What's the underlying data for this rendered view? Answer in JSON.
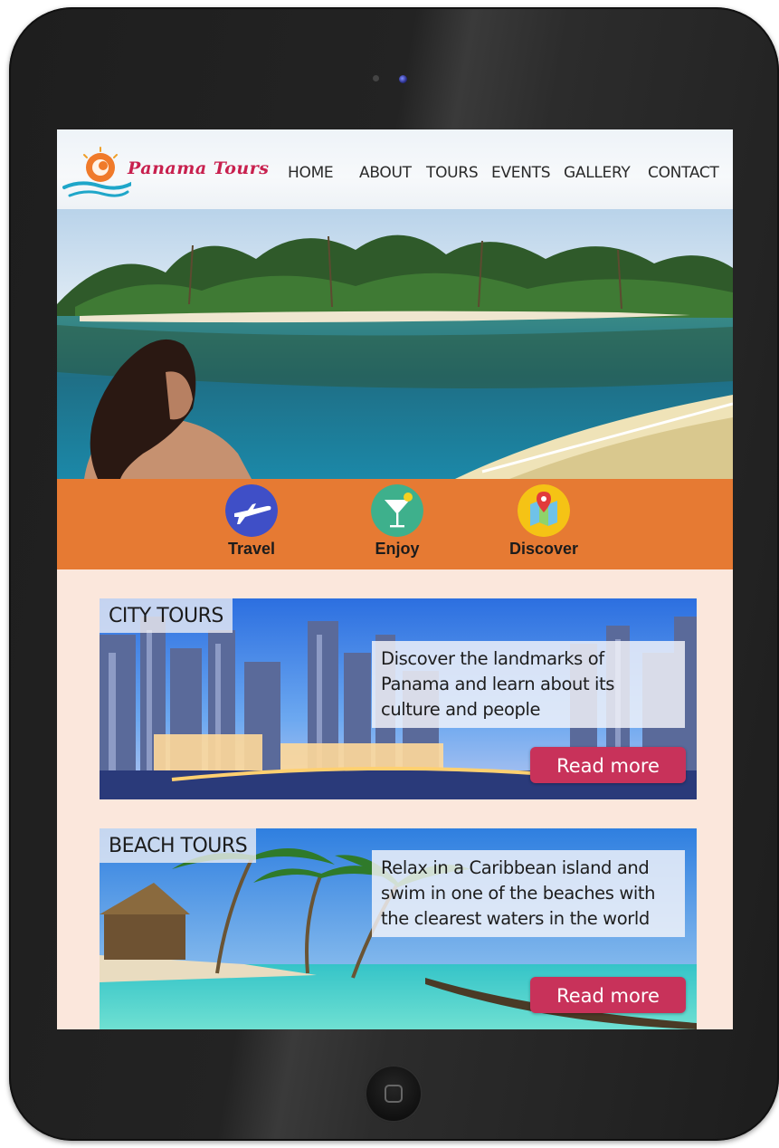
{
  "brand": {
    "name": "Panama Tours",
    "accent": "#c8204e"
  },
  "nav": {
    "items": [
      {
        "label": "HOME"
      },
      {
        "label": "ABOUT"
      },
      {
        "label": "TOURS"
      },
      {
        "label": "EVENTS"
      },
      {
        "label": "GALLERY"
      },
      {
        "label": "CONTACT"
      }
    ]
  },
  "features": {
    "bar_color": "#e67a33",
    "items": [
      {
        "label": "Travel",
        "icon": "airplane-icon",
        "color": "#3f4fc7"
      },
      {
        "label": "Enjoy",
        "icon": "cocktail-icon",
        "color": "#3eb08c"
      },
      {
        "label": "Discover",
        "icon": "map-pin-icon",
        "color": "#f5c315"
      }
    ]
  },
  "cards": [
    {
      "title": "CITY TOURS",
      "description": "Discover the landmarks of Panama and learn about its culture and people",
      "button": "Read more"
    },
    {
      "title": "BEACH TOURS",
      "description": "Relax in a Caribbean island and swim in one of the beaches with the clearest waters in the world",
      "button": "Read more"
    }
  ],
  "button_color": "#c8325a"
}
